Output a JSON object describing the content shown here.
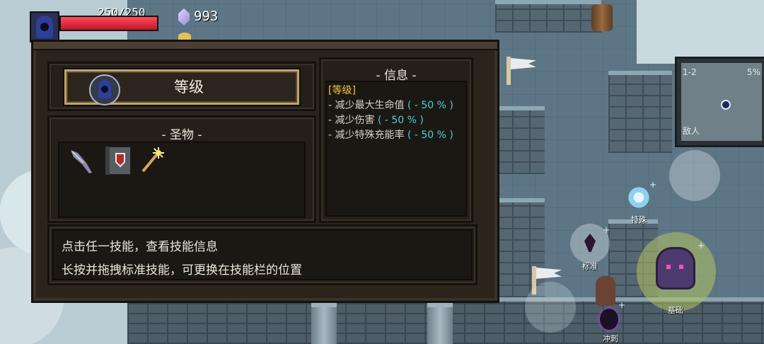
{
  "hud": {
    "hp_text": "250/250",
    "hp_fraction": 1.0,
    "gem_count": "993"
  },
  "minimap": {
    "level": "1-2",
    "percent": "5%",
    "enemy_label": "敌人"
  },
  "panel": {
    "level_button_label": "等级",
    "relics_title": "- 圣物 -",
    "relics": [
      "feather-quill-icon",
      "spellbook-icon",
      "magic-wand-icon"
    ],
    "info_title": "- 信息 -",
    "info_heading": "[等级]",
    "info_items": [
      {
        "text": "- 减少最大生命值 ",
        "value": "( - 50 % )"
      },
      {
        "text": "- 减少伤害 ",
        "value": "( - 50 % )"
      },
      {
        "text": "- 减少特殊充能率 ",
        "value": "( - 50 % )"
      }
    ],
    "tip_line1": "点击任一技能，查看技能信息",
    "tip_line2": "长按并拖拽标准技能，可更换在技能栏的位置"
  },
  "skills": {
    "special": "特殊",
    "standard": "标准",
    "basic": "基础",
    "dash": "冲刺"
  },
  "colors": {
    "panel_bg": "#2a241d",
    "button_border": "#c2a468",
    "highlight": "#f2c744",
    "value_cyan": "#49d1d8",
    "hp_red": "#d91f35"
  }
}
